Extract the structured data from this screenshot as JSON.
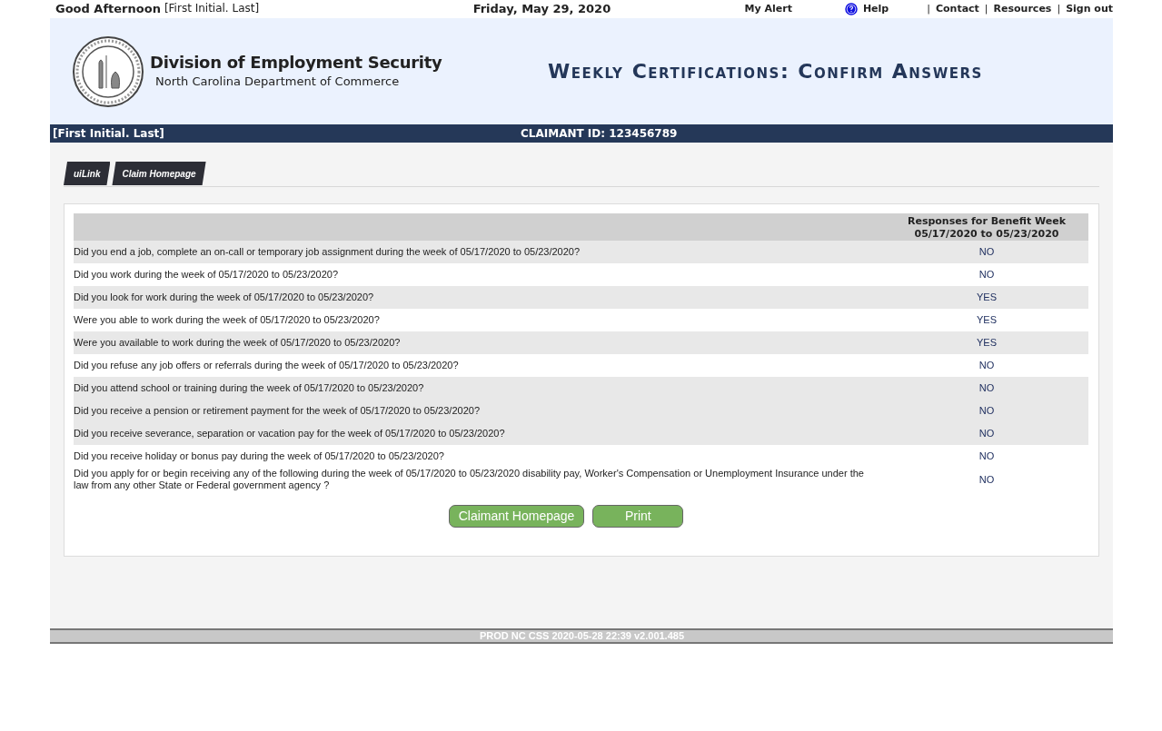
{
  "top_bar": {
    "greeting": "Good Afternoon",
    "user_name": "[First Initial. Last]",
    "date": "Friday, May 29, 2020",
    "links": [
      {
        "label": "My Alert",
        "kind": "plain"
      },
      {
        "label": "Help",
        "kind": "help"
      },
      {
        "label": "|",
        "kind": "separator"
      },
      {
        "label": "Contact",
        "kind": "link"
      },
      {
        "label": "|",
        "kind": "separator"
      },
      {
        "label": "Resources",
        "kind": "link"
      },
      {
        "label": "|",
        "kind": "separator"
      },
      {
        "label": "Sign out",
        "kind": "link"
      }
    ]
  },
  "header": {
    "org_name": "Division of Employment Security",
    "org_subtitle": "North Carolina Department of Commerce",
    "page_title": "Weekly Certifications: Confirm Answers"
  },
  "claimant_bar": {
    "name": "[First Initial. Last]",
    "claimant_id": "CLAIMANT ID: 123456789"
  },
  "tabs": [
    {
      "label": "uiLink"
    },
    {
      "label": "Claim Homepage"
    }
  ],
  "table": {
    "columns": [
      "",
      "Responses for Benefit Week 05/17/2020 to 05/23/2020"
    ],
    "rows": [
      {
        "question": "Did you end a job, complete an on-call or temporary job assignment during the week of 05/17/2020 to 05/23/2020?",
        "answer": "NO",
        "shaded": true
      },
      {
        "question": "Did you work during the week of 05/17/2020 to 05/23/2020?",
        "answer": "NO",
        "shaded": false
      },
      {
        "question": "Did you look for work during the week of 05/17/2020 to 05/23/2020?",
        "answer": "YES",
        "shaded": true
      },
      {
        "question": "Were you able to work during the week of 05/17/2020 to 05/23/2020?",
        "answer": "YES",
        "shaded": false
      },
      {
        "question": "Were you available to work during the week of 05/17/2020 to 05/23/2020?",
        "answer": "YES",
        "shaded": true
      },
      {
        "question": "Did you refuse any job offers or referrals during the week of 05/17/2020 to 05/23/2020?",
        "answer": "NO",
        "shaded": false
      },
      {
        "question": "Did you attend school or training during the week of 05/17/2020 to 05/23/2020?",
        "answer": "NO",
        "shaded": true
      },
      {
        "question": "Did you receive a pension or retirement payment for the week of 05/17/2020 to 05/23/2020?",
        "answer": "NO",
        "shaded": true
      },
      {
        "question": "Did you receive severance, separation or vacation pay for the week of 05/17/2020 to 05/23/2020?",
        "answer": "NO",
        "shaded": true
      },
      {
        "question": "Did you receive holiday or bonus pay during the week of 05/17/2020 to 05/23/2020?",
        "answer": "NO",
        "shaded": false
      },
      {
        "question": "Did you apply for or begin receiving any of the following during the week of 05/17/2020 to 05/23/2020 disability pay, Worker's Compensation or Unemployment Insurance under the law from any other State or Federal government agency ?",
        "answer": "NO",
        "shaded": false
      }
    ]
  },
  "buttons": [
    "Claimant Homepage",
    "Print"
  ],
  "footer": "PROD NC CSS 2020-05-28 22:39 v2.001.485"
}
